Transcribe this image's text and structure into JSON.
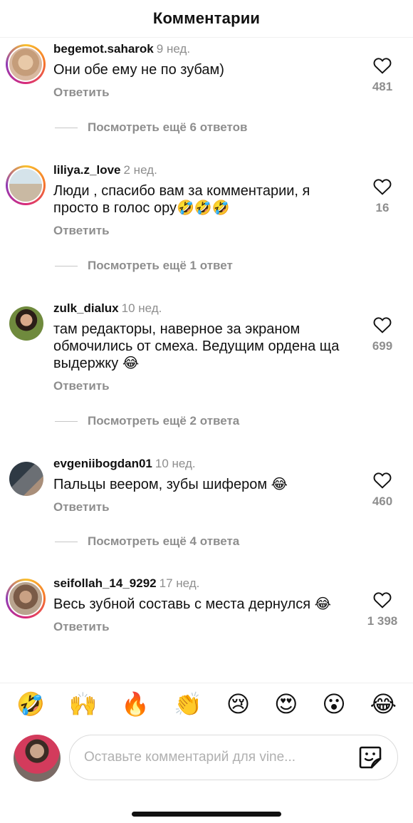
{
  "header": {
    "title": "Комментарии"
  },
  "reply_label": "Ответить",
  "comments": [
    {
      "username": "begemot.saharok",
      "time": "9 нед.",
      "text": "Они обе ему не по зубам)",
      "likes": "481",
      "more_replies": "Посмотреть ещё 6 ответов"
    },
    {
      "username": "liliya.z_love",
      "time": "2 нед.",
      "text": "Люди , спасибо вам за комментарии, я просто в голос ору🤣🤣🤣",
      "likes": "16",
      "more_replies": "Посмотреть ещё 1 ответ"
    },
    {
      "username": "zulk_dialux",
      "time": "10 нед.",
      "text": "там редакторы, наверное за экраном обмочились от смеха. Ведущим ордена ща выдержку 😂",
      "likes": "699",
      "more_replies": "Посмотреть ещё 2 ответа"
    },
    {
      "username": "evgeniibogdan01",
      "time": "10 нед.",
      "text": "Пальцы веером, зубы шифером 😂",
      "likes": "460",
      "more_replies": "Посмотреть ещё 4 ответа"
    },
    {
      "username": "seifollah_14_9292",
      "time": "17 нед.",
      "text": "Весь зубной составь с места дернулся 😂",
      "likes": "1 398"
    }
  ],
  "emoji_bar": [
    "🤣",
    "🙌",
    "🔥",
    "👏",
    "😢",
    "😍",
    "😮",
    "😂"
  ],
  "composer": {
    "placeholder": "Оставьте комментарий для vine..."
  }
}
